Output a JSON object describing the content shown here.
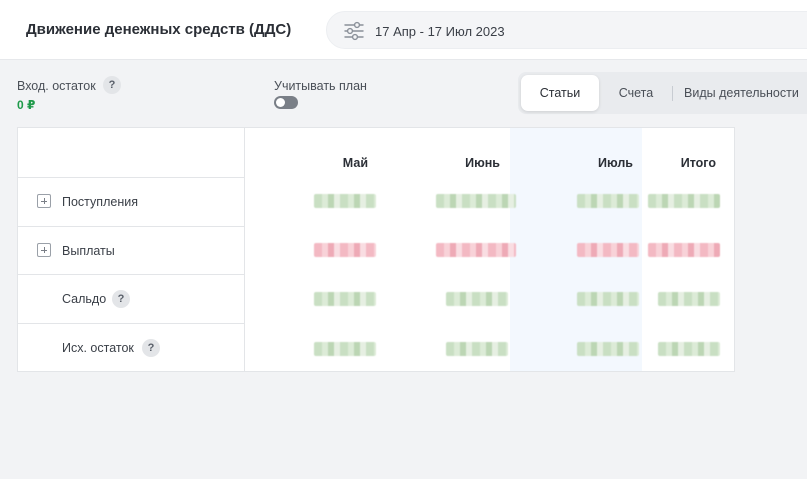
{
  "header": {
    "title": "Движение денежных средств (ДДС)",
    "date_range": "17 Апр - 17 Июл 2023",
    "filter_icon": "sliders-icon"
  },
  "summary": {
    "opening_label": "Вход. остаток",
    "opening_value": "0 ₽",
    "plan_label": "Учитывать план",
    "plan_enabled": false,
    "help_glyph": "?"
  },
  "tabs": [
    {
      "label": "Статьи",
      "active": true
    },
    {
      "label": "Счета",
      "active": false
    },
    {
      "label": "Виды деятельности",
      "active": false
    }
  ],
  "table": {
    "columns": [
      "Май",
      "Июнь",
      "Июль",
      "Итого"
    ],
    "rows": [
      {
        "label": "Поступления",
        "expandable": true,
        "tone": "positive"
      },
      {
        "label": "Выплаты",
        "expandable": true,
        "tone": "negative"
      },
      {
        "label": "Сальдо",
        "expandable": false,
        "tone": "positive"
      },
      {
        "label": "Исх. остаток",
        "expandable": false,
        "tone": "positive"
      }
    ]
  },
  "colors": {
    "accent_positive": "#1f9a4a",
    "highlight_column": "#f3f8fe"
  }
}
